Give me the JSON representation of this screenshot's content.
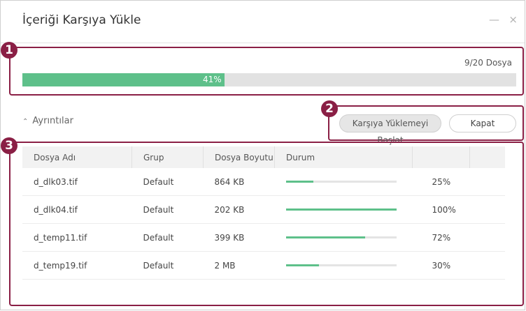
{
  "dialog": {
    "title": "İçeriği Karşıya Yükle",
    "minimize_glyph": "—",
    "close_glyph": "×"
  },
  "upload": {
    "file_count": "9/20 Dosya",
    "progress_fraction": 0.41,
    "progress_label": "41%"
  },
  "details": {
    "toggle_label": "Ayrıntılar",
    "toggle_icon": "chevron-up-icon"
  },
  "buttons": {
    "start_label": "Karşıya Yüklemeyi Başlat",
    "close_label": "Kapat"
  },
  "callouts": [
    "1",
    "2",
    "3"
  ],
  "table": {
    "headers": [
      "Dosya Adı",
      "Grup",
      "Dosya Boyutu",
      "Durum"
    ],
    "rows": [
      {
        "name": "d_dlk03.tif",
        "group": "Default",
        "size": "864 KB",
        "progress": 0.25,
        "percent": "25%"
      },
      {
        "name": "d_dlk04.tif",
        "group": "Default",
        "size": "202 KB",
        "progress": 1.0,
        "percent": "100%"
      },
      {
        "name": "d_temp11.tif",
        "group": "Default",
        "size": "399 KB",
        "progress": 0.72,
        "percent": "72%"
      },
      {
        "name": "d_temp19.tif",
        "group": "Default",
        "size": "2 MB",
        "progress": 0.3,
        "percent": "30%"
      }
    ]
  },
  "colors": {
    "accent_green": "#5ec08a",
    "callout": "#8a1f45"
  }
}
